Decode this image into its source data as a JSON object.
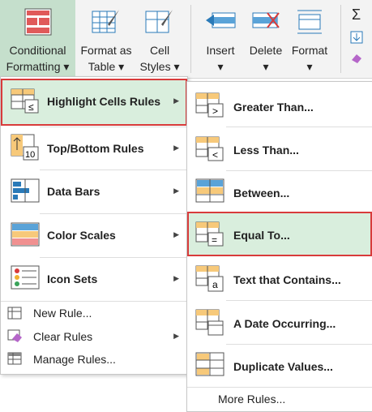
{
  "ribbon": {
    "conditional_formatting": {
      "line1": "Conditional",
      "line2": "Formatting ▾"
    },
    "format_as_table": {
      "line1": "Format as",
      "line2": "Table ▾"
    },
    "cell_styles": {
      "line1": "Cell",
      "line2": "Styles ▾"
    },
    "insert": {
      "line1": "Insert",
      "line2": "▾"
    },
    "delete": {
      "line1": "Delete",
      "line2": "▾"
    },
    "format": {
      "line1": "Format",
      "line2": "▾"
    },
    "sigma": "Σ"
  },
  "main_menu": {
    "items": [
      {
        "label": "Highlight Cells Rules",
        "icon": "highlight-cells-icon"
      },
      {
        "label": "Top/Bottom Rules",
        "icon": "top-bottom-icon"
      },
      {
        "label": "Data Bars",
        "icon": "data-bars-icon"
      },
      {
        "label": "Color Scales",
        "icon": "color-scales-icon"
      },
      {
        "label": "Icon Sets",
        "icon": "icon-sets-icon"
      },
      {
        "label": "New Rule...",
        "icon": "new-rule-icon"
      },
      {
        "label": "Clear Rules",
        "icon": "clear-rules-icon"
      },
      {
        "label": "Manage Rules...",
        "icon": "manage-rules-icon"
      }
    ]
  },
  "sub_menu": {
    "items": [
      {
        "label": "Greater Than...",
        "icon": "greater-than-icon"
      },
      {
        "label": "Less Than...",
        "icon": "less-than-icon"
      },
      {
        "label": "Between...",
        "icon": "between-icon"
      },
      {
        "label": "Equal To...",
        "icon": "equal-to-icon"
      },
      {
        "label": "Text that Contains...",
        "icon": "text-contains-icon"
      },
      {
        "label": "A Date Occurring...",
        "icon": "date-occurring-icon"
      },
      {
        "label": "Duplicate Values...",
        "icon": "duplicate-values-icon"
      }
    ],
    "more_rules": "More Rules..."
  },
  "colors": {
    "highlight": "#d9eedd",
    "outline": "#d83b3b",
    "ribbon_active": "#c5dfcc"
  }
}
